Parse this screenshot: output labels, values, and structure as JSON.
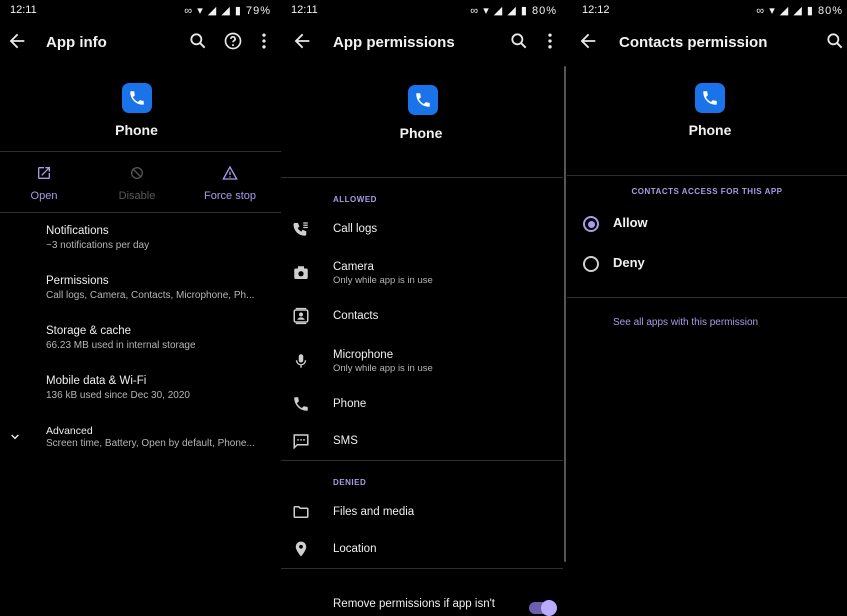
{
  "app_info": {
    "status": {
      "time": "12:11",
      "battery": "79%"
    },
    "title": "App info",
    "app_name": "Phone",
    "actions": [
      {
        "label": "Open",
        "icon": "open-in-new-icon"
      },
      {
        "label": "Disable",
        "icon": "disable-icon"
      },
      {
        "label": "Force stop",
        "icon": "warning-icon"
      }
    ],
    "items": [
      {
        "title": "Notifications",
        "subtitle": "~3 notifications per day"
      },
      {
        "title": "Permissions",
        "subtitle": "Call logs, Camera, Contacts, Microphone, Ph..."
      },
      {
        "title": "Storage & cache",
        "subtitle": "66.23 MB used in internal storage"
      },
      {
        "title": "Mobile data & Wi-Fi",
        "subtitle": "136 kB used since Dec 30, 2020"
      },
      {
        "title": "Advanced",
        "subtitle": "Screen time, Battery, Open by default, Phone..."
      }
    ]
  },
  "app_permissions": {
    "status": {
      "time": "12:11",
      "battery": "80%"
    },
    "title": "App permissions",
    "app_name": "Phone",
    "allowed_header": "ALLOWED",
    "allowed": [
      {
        "title": "Call logs",
        "subtitle": "",
        "icon": "call-log-icon"
      },
      {
        "title": "Camera",
        "subtitle": "Only while app is in use",
        "icon": "camera-icon"
      },
      {
        "title": "Contacts",
        "subtitle": "",
        "icon": "contacts-icon"
      },
      {
        "title": "Microphone",
        "subtitle": "Only while app is in use",
        "icon": "microphone-icon"
      },
      {
        "title": "Phone",
        "subtitle": "",
        "icon": "phone-icon"
      },
      {
        "title": "SMS",
        "subtitle": "",
        "icon": "sms-icon"
      }
    ],
    "denied_header": "DENIED",
    "denied": [
      {
        "title": "Files and media",
        "icon": "folder-icon"
      },
      {
        "title": "Location",
        "icon": "location-icon"
      }
    ],
    "remove_permissions_label": "Remove permissions if app isn't",
    "remove_permissions_enabled": true
  },
  "contacts_permission": {
    "status": {
      "time": "12:12",
      "battery": "80%"
    },
    "title": "Contacts permission",
    "app_name": "Phone",
    "section_header": "CONTACTS ACCESS FOR THIS APP",
    "options": [
      {
        "label": "Allow",
        "selected": true
      },
      {
        "label": "Deny",
        "selected": false
      }
    ],
    "see_all_link": "See all apps with this permission"
  },
  "colors": {
    "accent": "#a99be6",
    "app_icon": "#1a73e8",
    "background": "#000000"
  }
}
